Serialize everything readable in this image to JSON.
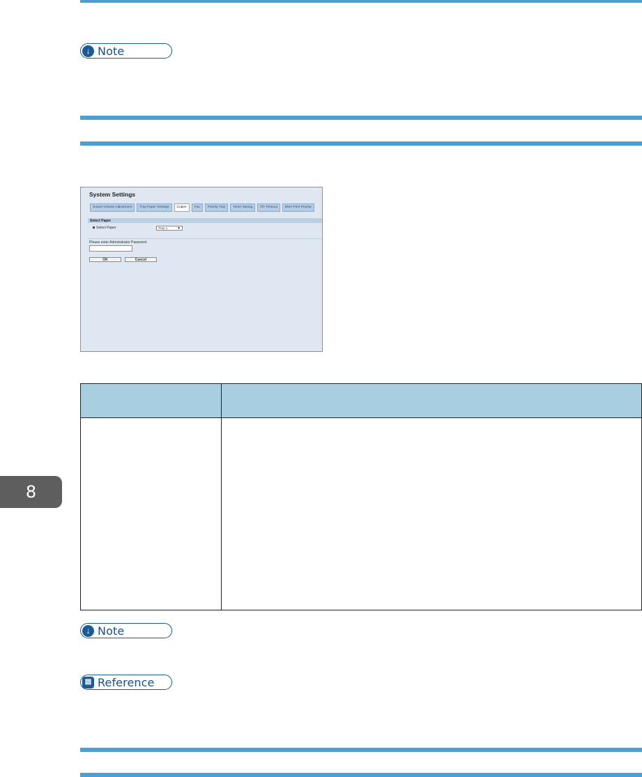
{
  "notes": [
    {
      "icon": "down-arrow-icon",
      "label": "Note"
    },
    {
      "icon": "down-arrow-icon",
      "label": "Note"
    }
  ],
  "reference": {
    "icon": "book-icon",
    "label": "Reference"
  },
  "screenshot": {
    "title": "System Settings",
    "tabs": [
      "Sound Volume Adjustment",
      "Tray Paper Settings",
      "Copier",
      "Fax",
      "Priority Tray",
      "Toner Saving",
      "I/O Timeout",
      "BMA Print Priority"
    ],
    "active_tab": "Copier",
    "section_label": "Select Paper",
    "select_label": "Select Paper",
    "select_value": "Tray 1",
    "password_prompt": "Please enter Administrator Password.",
    "ok_label": "OK",
    "cancel_label": "Cancel"
  },
  "chapter_number": "8",
  "colors": {
    "accent": "#4a9fd4",
    "badge": "#1a5a96",
    "table_header": "#a8cfe0",
    "chapter_tab": "#5e5e5e"
  }
}
